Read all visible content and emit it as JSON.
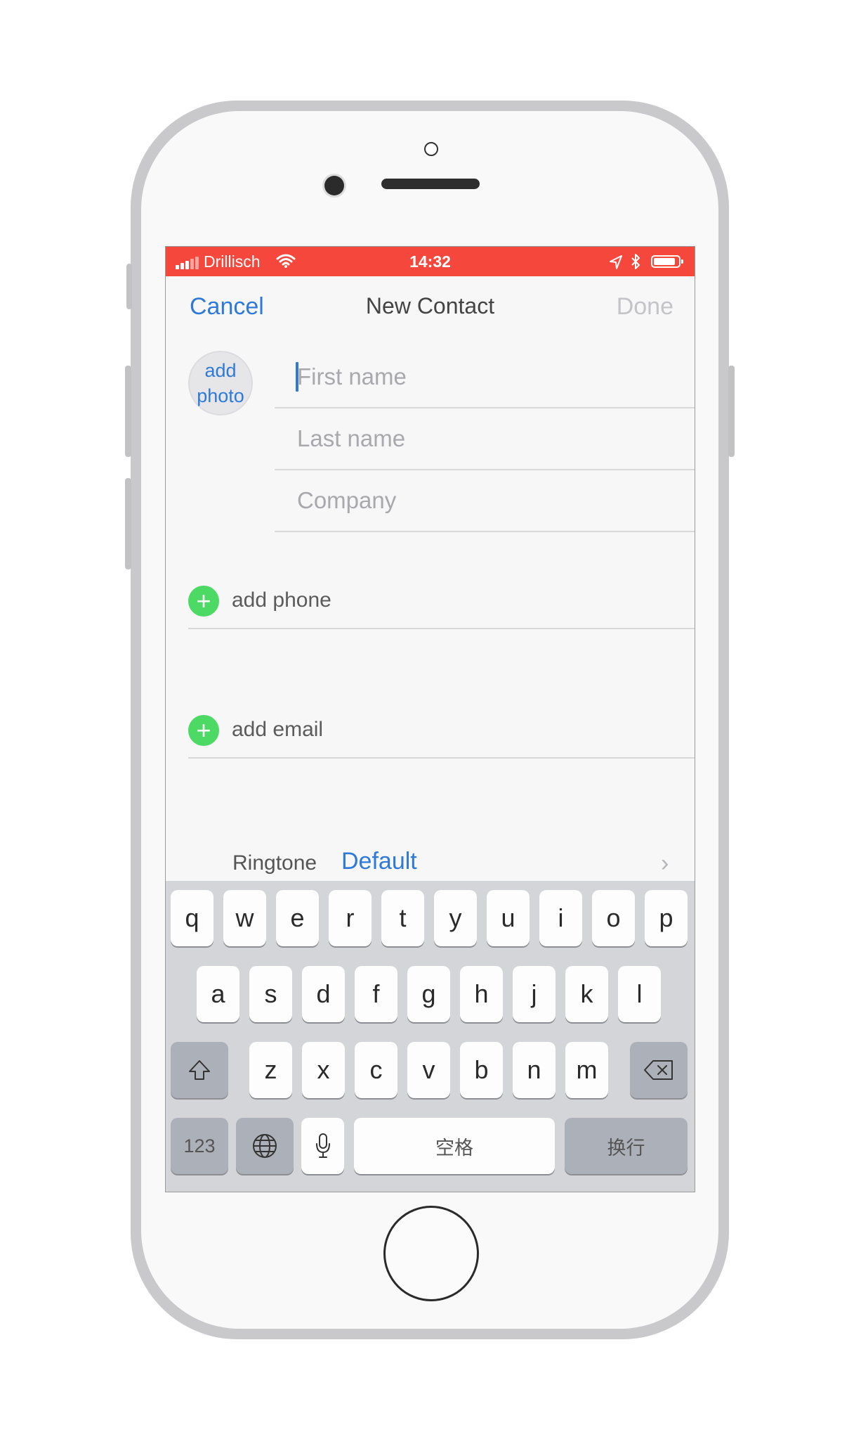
{
  "status_bar": {
    "carrier": "Drillisch",
    "time": "14:32"
  },
  "nav": {
    "cancel_label": "Cancel",
    "title": "New Contact",
    "done_label": "Done"
  },
  "photo": {
    "line1": "add",
    "line2": "photo"
  },
  "fields": [
    {
      "placeholder": "First name"
    },
    {
      "placeholder": "Last name"
    },
    {
      "placeholder": "Company"
    }
  ],
  "add_phone_label": "add phone",
  "add_email_label": "add email",
  "ringtone": {
    "label": "Ringtone",
    "value": "Default"
  },
  "keyboard": {
    "row1": [
      "q",
      "w",
      "e",
      "r",
      "t",
      "y",
      "u",
      "i",
      "o",
      "p"
    ],
    "row2": [
      "a",
      "s",
      "d",
      "f",
      "g",
      "h",
      "j",
      "k",
      "l"
    ],
    "row3": [
      "z",
      "x",
      "c",
      "v",
      "b",
      "n",
      "m"
    ],
    "numbers_label": "123",
    "space_label": "空格",
    "return_label": "换行"
  },
  "colors": {
    "accent": "#2f7ad9",
    "status_bar": "#f6473c",
    "add_green": "#4cd964"
  },
  "icons": [
    "signal-icon",
    "wifi-icon",
    "location-icon",
    "bluetooth-icon",
    "battery-icon",
    "plus-icon",
    "chevron-right-icon",
    "shift-icon",
    "delete-icon",
    "globe-icon",
    "microphone-icon"
  ]
}
